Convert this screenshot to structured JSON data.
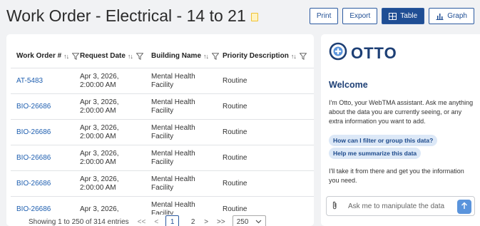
{
  "header": {
    "title": "Work Order - Electrical - 14 to 21",
    "bookmark_icon": "bookmark-icon",
    "buttons": {
      "print": "Print",
      "export": "Export",
      "table": "Table",
      "graph": "Graph"
    }
  },
  "table": {
    "columns": [
      "Work Order #",
      "Request Date",
      "Building Name",
      "Priority Description"
    ],
    "rows": [
      {
        "work_order": "AT-5483",
        "date_line1": "Apr 3, 2026,",
        "date_line2": "2:00:00 AM",
        "building": "Mental Health Facility",
        "priority": "Routine"
      },
      {
        "work_order": "BIO-26686",
        "date_line1": "Apr 3, 2026,",
        "date_line2": "2:00:00 AM",
        "building": "Mental Health Facility",
        "priority": "Routine"
      },
      {
        "work_order": "BIO-26686",
        "date_line1": "Apr 3, 2026,",
        "date_line2": "2:00:00 AM",
        "building": "Mental Health Facility",
        "priority": "Routine"
      },
      {
        "work_order": "BIO-26686",
        "date_line1": "Apr 3, 2026,",
        "date_line2": "2:00:00 AM",
        "building": "Mental Health Facility",
        "priority": "Routine"
      },
      {
        "work_order": "BIO-26686",
        "date_line1": "Apr 3, 2026,",
        "date_line2": "2:00:00 AM",
        "building": "Mental Health Facility",
        "priority": "Routine"
      },
      {
        "work_order": "BIO-26686",
        "date_line1": "Apr 3, 2026,",
        "date_line2": "",
        "building": "Mental Health Facility",
        "priority": "Routine"
      }
    ],
    "sort_glyph": "↑↓"
  },
  "pager": {
    "info": "Showing 1 to 250 of 314 entries",
    "first": "<<",
    "prev": "<",
    "pages": [
      "1",
      "2"
    ],
    "current_page": "1",
    "next": ">",
    "last": ">>",
    "page_size": "250"
  },
  "otto": {
    "brand": "OTTO",
    "welcome": "Welcome",
    "intro": "I'm Otto, your WebTMA assistant. Ask me anything about the data you are currently seeing, or any extra information you want to add.",
    "suggestions": [
      "How can I filter or group this data?",
      "Help me summarize this data"
    ],
    "outro": "I'll take it from there and get you the information you need.",
    "input_placeholder": "Ask me to manipulate the data",
    "accent_color": "#1d3f75"
  }
}
